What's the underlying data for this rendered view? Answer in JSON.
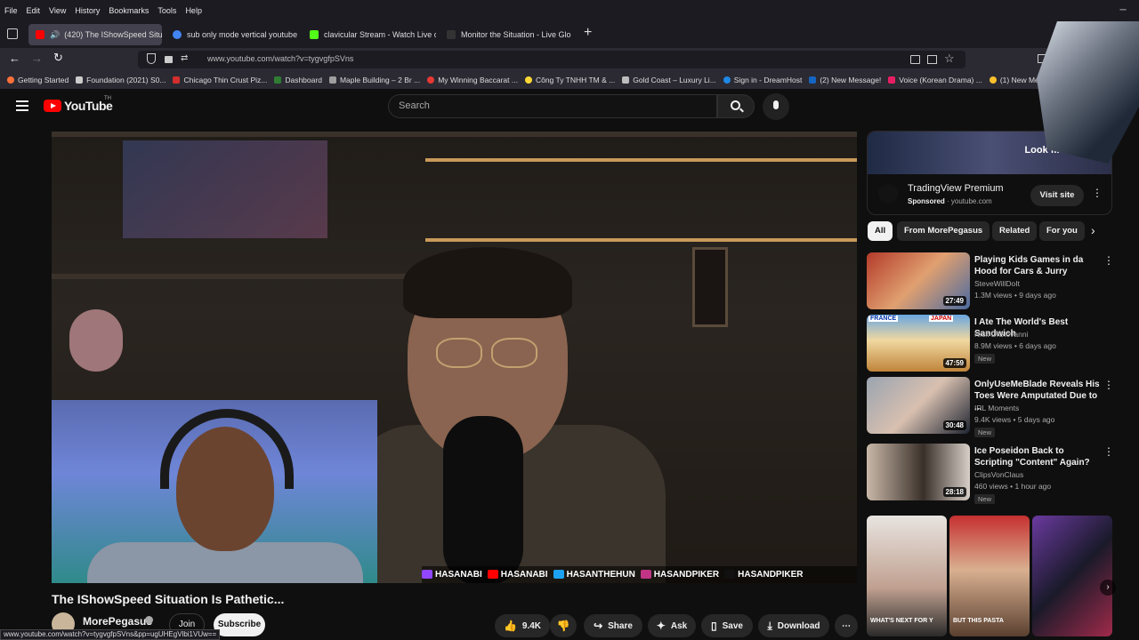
{
  "browser": {
    "menu": [
      "File",
      "Edit",
      "View",
      "History",
      "Bookmarks",
      "Tools",
      "Help"
    ],
    "tabs": [
      {
        "title": "(420) The IShowSpeed Situa",
        "color": "#ff0000"
      },
      {
        "title": "sub only mode vertical youtube",
        "color": "#4285f4"
      },
      {
        "title": "clavicular Stream - Watch Live o",
        "color": "#53fc18"
      },
      {
        "title": "Monitor the Situation - Live Glo",
        "color": "#333333"
      }
    ],
    "new_tab": "+",
    "url": "www.youtube.com/watch?v=tygvgfpSVns",
    "bookmarks": [
      {
        "label": "Getting Started",
        "color": "#ff7139"
      },
      {
        "label": "Foundation (2021) S0...",
        "color": "#cccccc"
      },
      {
        "label": "Chicago Thin Crust Piz...",
        "color": "#d32f2f"
      },
      {
        "label": "Dashboard",
        "color": "#2e7d32"
      },
      {
        "label": "Maple Building – 2 Br ...",
        "color": "#9e9e9e"
      },
      {
        "label": "My Winning Baccarat ...",
        "color": "#e53935"
      },
      {
        "label": "Công Ty TNHH TM & ...",
        "color": "#fdd835"
      },
      {
        "label": "Gold Coast – Luxury Li...",
        "color": "#bdbdbd"
      },
      {
        "label": "Sign in - DreamHost",
        "color": "#1e88e5"
      },
      {
        "label": "(2) New Message!",
        "color": "#1565c0"
      },
      {
        "label": "Voice (Korean Drama) ...",
        "color": "#e91e63"
      },
      {
        "label": "(1) New Messa",
        "color": "#fbc02d"
      }
    ],
    "status_url": "www.youtube.com/watch?v=tygvgfpSVns&pp=ugUHEgVlbi1VUw=="
  },
  "youtube": {
    "logo_text": "YouTube",
    "logo_sup": "TH",
    "search_placeholder": "Search",
    "video": {
      "title": "The IShowSpeed Situation Is Pathetic...",
      "channel": "MorePegasus",
      "join": "Join",
      "subscribe": "Subscribe",
      "likes": "9.4K",
      "share": "Share",
      "ask": "Ask",
      "save": "Save",
      "download": "Download",
      "overlay_handles": [
        "HASANABI",
        "HASANABI",
        "HASANTHEHUN",
        "HASANDPIKER",
        "HASANDPIKER"
      ]
    },
    "ad": {
      "headline": "Look first / Then",
      "title": "TradingView Premium",
      "sponsored": "Sponsored",
      "domain": "youtube.com",
      "visit": "Visit site"
    },
    "chips": [
      "All",
      "From MorePegasus",
      "Related",
      "For you"
    ],
    "recommendations": [
      {
        "title": "Playing Kids Games in da Hood for Cars & Jurry",
        "channel": "SteveWillDoIt",
        "stats": "1.3M views • 9 days ago",
        "duration": "27:49",
        "new": ""
      },
      {
        "title": "I Ate The World's Best Sandwich",
        "channel": "Nick DiGiovanni",
        "stats": "8.9M views • 6 days ago",
        "duration": "47:59",
        "new": "New"
      },
      {
        "title": "OnlyUseMeBlade Reveals His Toes Were Amputated Due to ...",
        "channel": "IRL Moments",
        "stats": "9.4K views • 5 days ago",
        "duration": "30:48",
        "new": "New"
      },
      {
        "title": "Ice Poseidon Back to Scripting \"Content\" Again?",
        "channel": "ClipsVonClaus",
        "stats": "460 views • 1 hour ago",
        "duration": "28:18",
        "new": "New"
      }
    ],
    "shorts_captions": [
      "WHAT'S NEXT FOR Y",
      "BUT THIS PASTA",
      ""
    ],
    "rec2_badges": [
      "FRANCE",
      "JAPAN"
    ]
  }
}
